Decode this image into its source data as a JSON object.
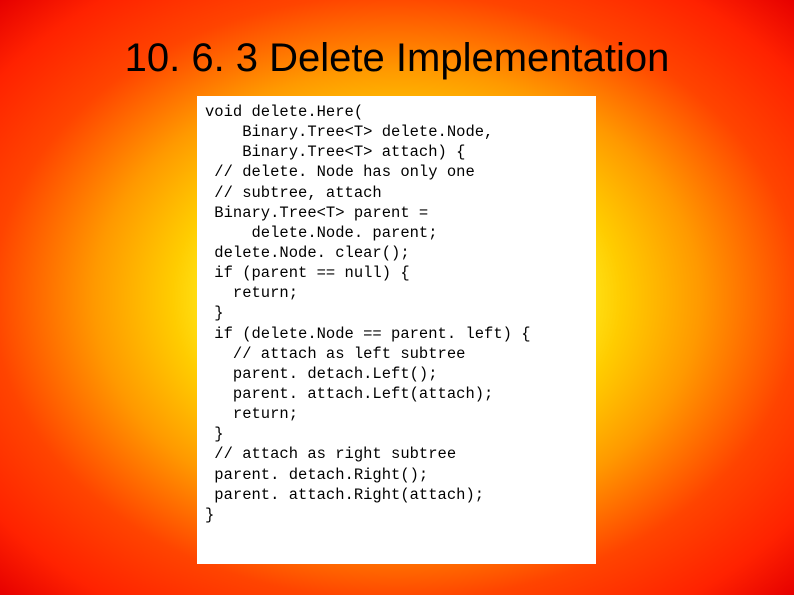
{
  "slide": {
    "title": "10. 6. 3 Delete Implementation",
    "code": "void delete.Here(\n    Binary.Tree<T> delete.Node,\n    Binary.Tree<T> attach) {\n // delete. Node has only one\n // subtree, attach\n Binary.Tree<T> parent =\n     delete.Node. parent;\n delete.Node. clear();\n if (parent == null) {\n   return;\n }\n if (delete.Node == parent. left) {\n   // attach as left subtree\n   parent. detach.Left();\n   parent. attach.Left(attach);\n   return;\n }\n // attach as right subtree\n parent. detach.Right();\n parent. attach.Right(attach);\n}"
  }
}
